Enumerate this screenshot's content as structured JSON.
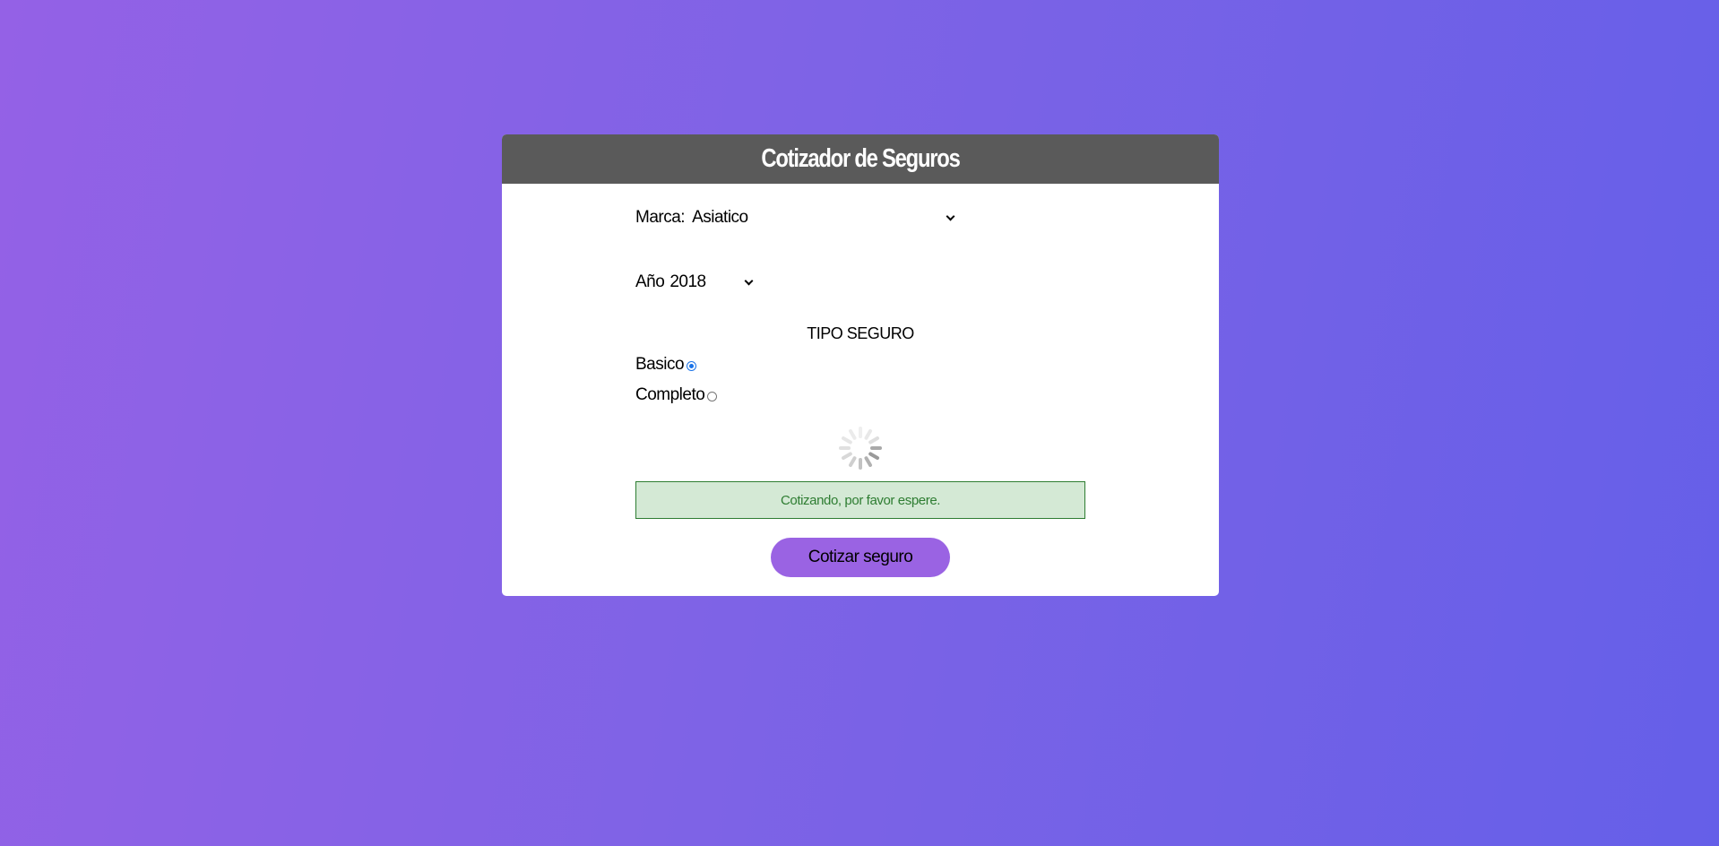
{
  "header": {
    "title": "Cotizador de Seguros"
  },
  "form": {
    "marca": {
      "label": "Marca:",
      "value": "Asiatico"
    },
    "year": {
      "label": "Año",
      "value": "2018"
    },
    "tipo": {
      "title": "TIPO SEGURO",
      "options": [
        {
          "label": "Basico",
          "checked": true
        },
        {
          "label": "Completo",
          "checked": false
        }
      ]
    },
    "alert": {
      "message": "Cotizando, por favor espere."
    },
    "submit_label": "Cotizar seguro"
  },
  "colors": {
    "header_bg": "#5a5a5a",
    "button_bg": "#9a63e3",
    "alert_bg": "#d4e9d5",
    "alert_text": "#2e7d32"
  }
}
